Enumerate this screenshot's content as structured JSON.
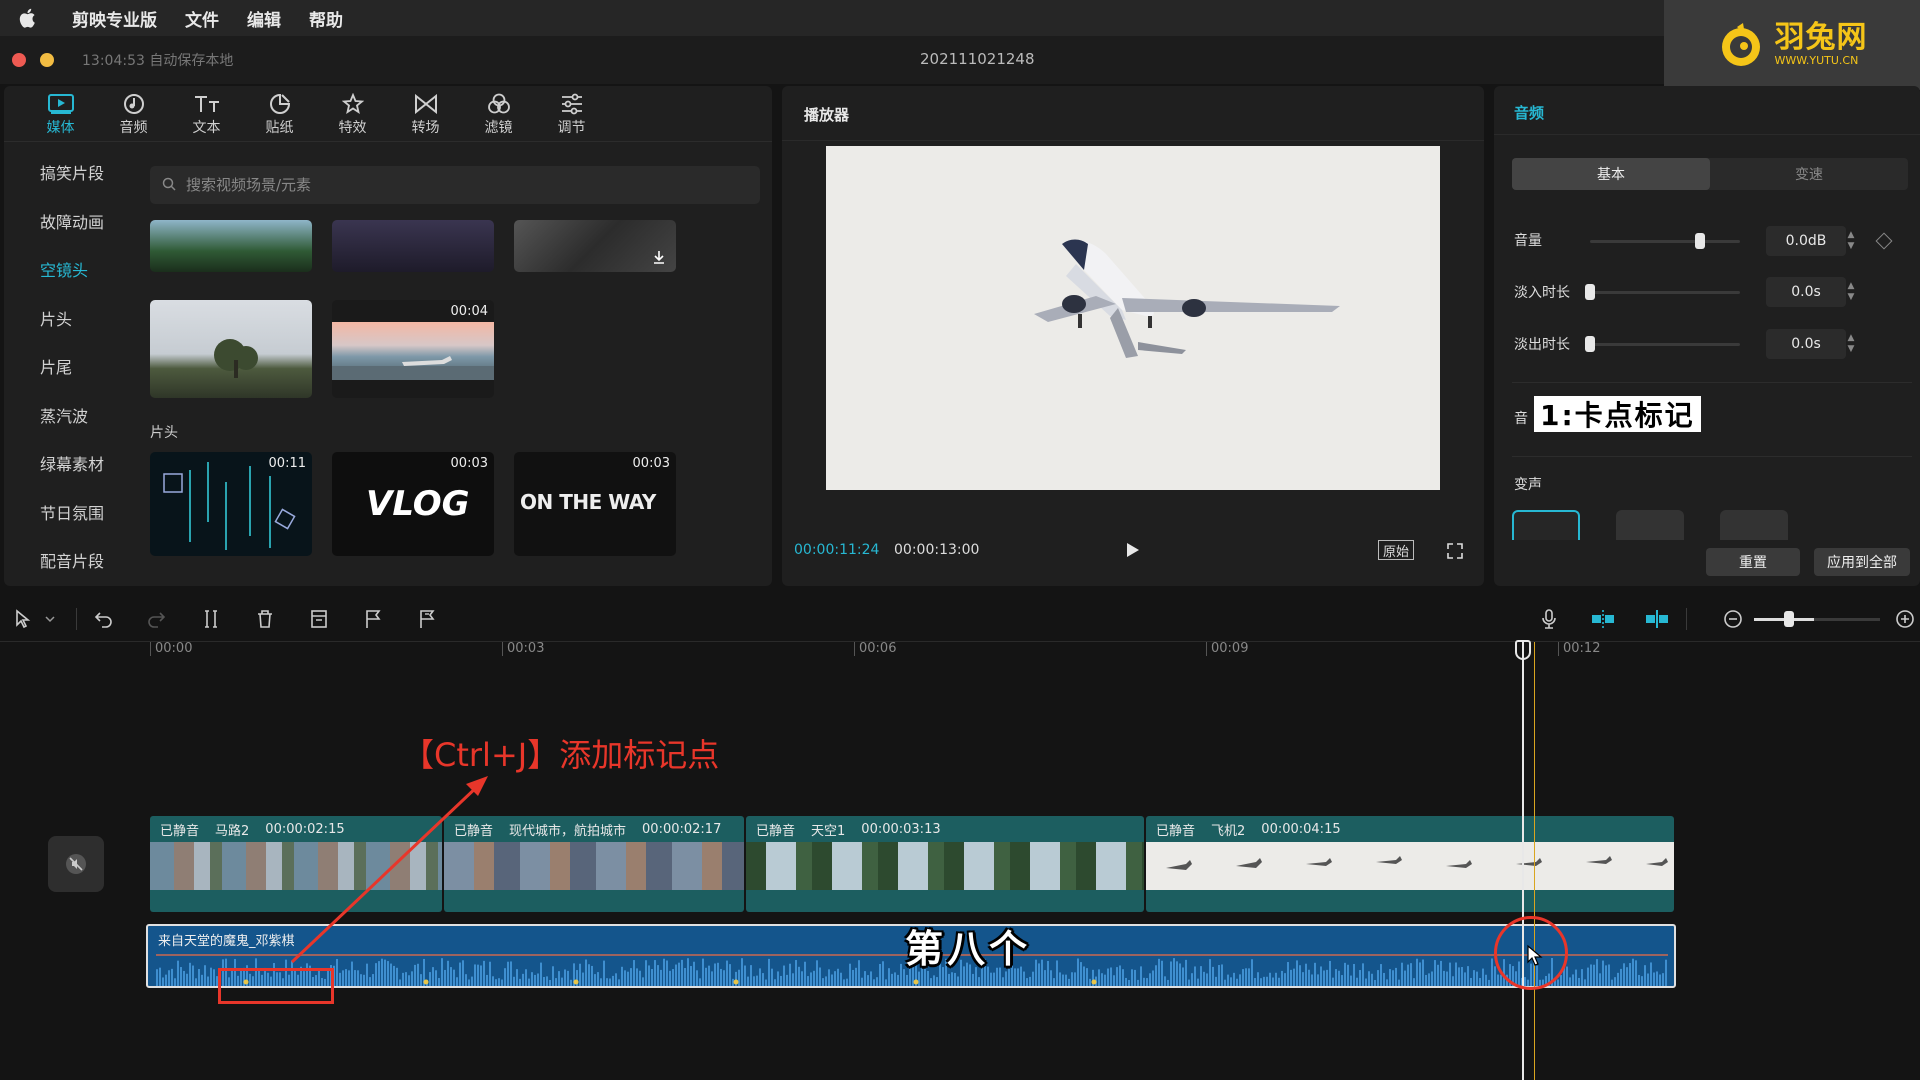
{
  "menubar": {
    "app": "剪映专业版",
    "items": [
      "文件",
      "编辑",
      "帮助"
    ]
  },
  "titlebar": {
    "autosave": "13:04:53 自动保存本地",
    "project": "202111021248"
  },
  "logo": {
    "name": "羽兔网",
    "url": "WWW.YUTU.CN",
    "color": "#f5c518"
  },
  "media_tabs": [
    {
      "label": "媒体",
      "icon": "media-icon",
      "active": true
    },
    {
      "label": "音频",
      "icon": "audio-icon"
    },
    {
      "label": "文本",
      "icon": "text-icon"
    },
    {
      "label": "贴纸",
      "icon": "sticker-icon"
    },
    {
      "label": "特效",
      "icon": "effects-icon"
    },
    {
      "label": "转场",
      "icon": "transition-icon"
    },
    {
      "label": "滤镜",
      "icon": "filter-icon"
    },
    {
      "label": "调节",
      "icon": "adjust-icon"
    }
  ],
  "categories": [
    "搞笑片段",
    "故障动画",
    "空镜头",
    "片头",
    "片尾",
    "蒸汽波",
    "绿幕素材",
    "节日氛围",
    "配音片段"
  ],
  "active_category": "空镜头",
  "search": {
    "placeholder": "搜索视频场景/元素"
  },
  "assets": {
    "durations": [
      "00:04",
      "00:11",
      "00:03",
      "00:03"
    ],
    "section": "片头",
    "vlog_text": "VLOG",
    "onway_text": "ON THE WAY"
  },
  "player": {
    "title": "播放器",
    "current": "00:00:11:24",
    "total": "00:00:13:00",
    "original": "原始"
  },
  "audio_panel": {
    "title": "音频",
    "tabs": [
      "基本",
      "变速"
    ],
    "volume": {
      "label": "音量",
      "value": "0.0dB",
      "level": 0.73
    },
    "fade_in": {
      "label": "淡入时长",
      "value": "0.0s",
      "level": 0
    },
    "fade_out": {
      "label": "淡出时长",
      "value": "0.0s",
      "level": 0
    },
    "partial_label": "音",
    "caption": "1:卡点标记",
    "voice_label": "变声",
    "reset": "重置",
    "apply_all": "应用到全部"
  },
  "ruler": [
    "00:00",
    "00:03",
    "00:06",
    "00:09",
    "00:12"
  ],
  "clips": [
    {
      "muted": "已静音",
      "name": "马路2",
      "duration": "00:00:02:15"
    },
    {
      "muted": "已静音",
      "name": "现代城市，航拍城市",
      "duration": "00:00:02:17"
    },
    {
      "muted": "已静音",
      "name": "天空1",
      "duration": "00:00:03:13"
    },
    {
      "muted": "已静音",
      "name": "飞机2",
      "duration": "00:00:04:15"
    }
  ],
  "audio_track": {
    "name": "来自天堂的魔鬼_邓紫棋",
    "color": "#14558c"
  },
  "overlay": {
    "annotation": "【Ctrl+J】添加标记点",
    "subtitle": "第八个",
    "annotation_color": "#e8362a"
  },
  "accent": "#27b8d3"
}
